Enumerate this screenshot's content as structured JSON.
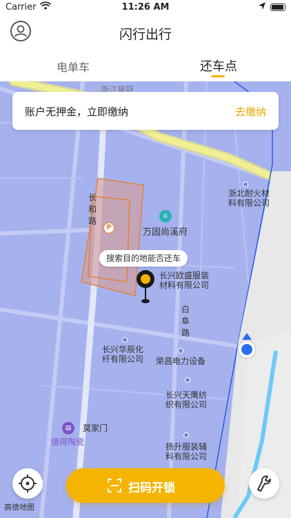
{
  "status_bar": {
    "carrier": "Carrier",
    "time": "11:26 AM"
  },
  "header": {
    "title": "闪行出行"
  },
  "tabs": [
    {
      "label": "电单车",
      "active": false
    },
    {
      "label": "还车点",
      "active": true
    }
  ],
  "banner": {
    "message": "账户无押金，立即缴纳",
    "action": "去缴纳"
  },
  "map": {
    "tooltip": "搜索目的地能否还车",
    "partial_label": "浙江泉冠",
    "roads": {
      "changhe": "长和路",
      "baifu": "白阜路"
    },
    "pois": {
      "wangu": "万固尚溪府",
      "zhebei": [
        "浙北耐火材",
        "料有限公司"
      ],
      "ousheng": [
        "长兴欧盛服装",
        "材料有限公司"
      ],
      "huachen": [
        "长兴华辰化",
        "纤有限公司"
      ],
      "rongchang": "荣昌电力设备",
      "tianying": [
        "长兴天鹰纺",
        "织有限公司"
      ],
      "mojiamen": "莫家门",
      "zhide": "值得陶瓷",
      "yangsheng": [
        "扬升服装辅",
        "料有限公司"
      ]
    },
    "parking_badge": "P",
    "logo": "高德地图"
  },
  "scan_button": {
    "label": "扫码开锁"
  },
  "colors": {
    "accent": "#f5b400",
    "map_bg": "#a6b2ee",
    "parking_zone": "#e87a2a",
    "my_location": "#2a6ef0"
  },
  "icons": {
    "avatar": "user-icon",
    "locate": "crosshair-icon",
    "wrench": "wrench-icon",
    "scan": "scan-icon",
    "pin": "map-pin-icon"
  }
}
